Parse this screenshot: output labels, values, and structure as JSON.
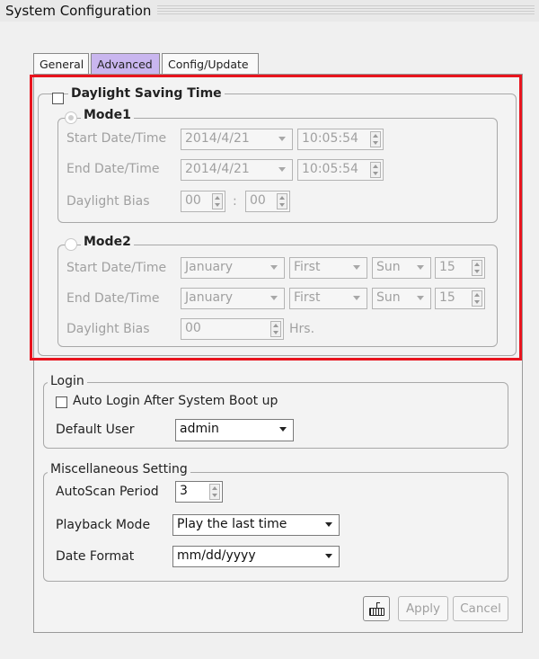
{
  "window": {
    "title": "System Configuration"
  },
  "tabs": [
    {
      "label": "General"
    },
    {
      "label": "Advanced"
    },
    {
      "label": "Config/Update"
    }
  ],
  "dst": {
    "label": "Daylight Saving Time",
    "checked": false,
    "mode1": {
      "label": "Mode1",
      "start_label": "Start Date/Time",
      "start_date": "2014/4/21",
      "start_time": "10:05:54",
      "end_label": "End Date/Time",
      "end_date": "2014/4/21",
      "end_time": "10:05:54",
      "bias_label": "Daylight Bias",
      "bias_hours": "00",
      "bias_sep": ":",
      "bias_minutes": "00"
    },
    "mode2": {
      "label": "Mode2",
      "start_label": "Start Date/Time",
      "start_month": "January",
      "start_week": "First",
      "start_day": "Sun",
      "start_hour": "15",
      "end_label": "End Date/Time",
      "end_month": "January",
      "end_week": "First",
      "end_day": "Sun",
      "end_hour": "15",
      "bias_label": "Daylight Bias",
      "bias_value": "00",
      "bias_unit": "Hrs."
    }
  },
  "login": {
    "label": "Login",
    "auto_login_label": "Auto Login After System Boot up",
    "auto_login_checked": false,
    "default_user_label": "Default User",
    "default_user": "admin"
  },
  "misc": {
    "label": "Miscellaneous Setting",
    "autoscan_label": "AutoScan Period",
    "autoscan_value": "3",
    "playback_label": "Playback Mode",
    "playback_value": "Play the last time",
    "date_format_label": "Date Format",
    "date_format_value": "mm/dd/yyyy"
  },
  "footer": {
    "keyboard_icon": "keyboard-icon",
    "apply_label": "Apply",
    "cancel_label": "Cancel"
  },
  "colors": {
    "active_tab": "#c9b6ef",
    "highlight_border": "#e8141e"
  }
}
